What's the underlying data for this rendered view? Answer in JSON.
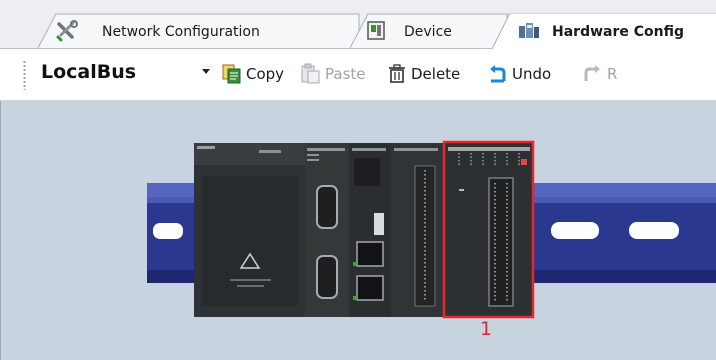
{
  "tabs": [
    {
      "label": "Network Configuration",
      "icon": "tools-icon",
      "active": false
    },
    {
      "label": "Device",
      "icon": "device-icon",
      "active": false
    },
    {
      "label": "Hardware Config",
      "icon": "hardware-config-icon",
      "active": true
    }
  ],
  "toolbar": {
    "bus_name": "LocalBus",
    "copy_label": "Copy",
    "paste_label": "Paste",
    "delete_label": "Delete",
    "undo_label": "Undo",
    "redo_label": "R"
  },
  "canvas": {
    "selected_slot_number": "1"
  },
  "colors": {
    "selection": "#e8262b",
    "slot_number": "#d8262b",
    "canvas_bg": "#c7d3df",
    "rail": "#2a3890"
  }
}
